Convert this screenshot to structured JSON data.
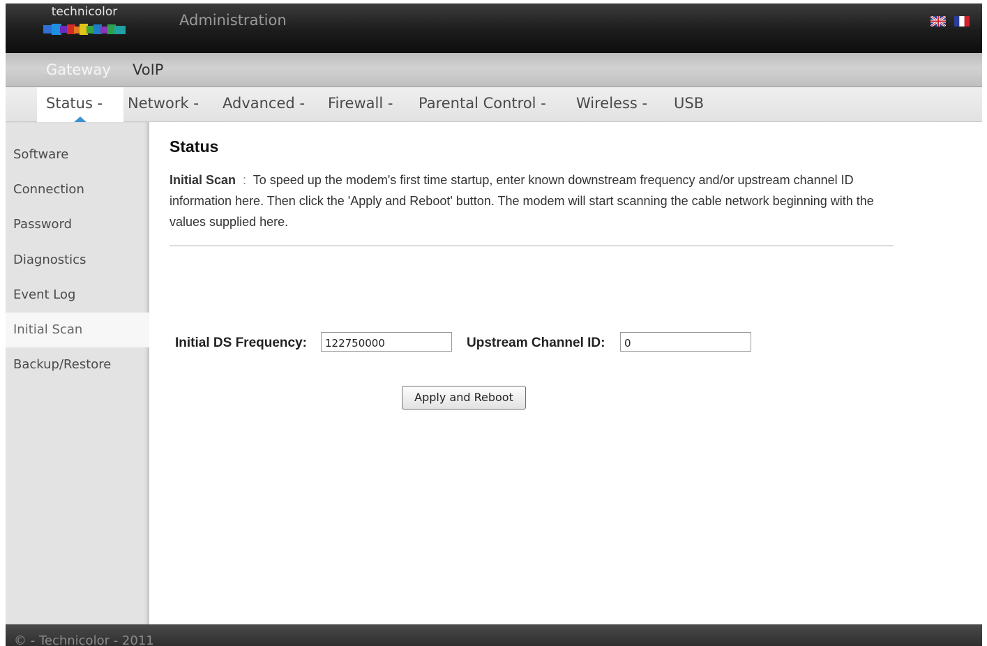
{
  "header": {
    "brand": "technicolor",
    "title": "Administration",
    "languages": [
      {
        "name": "uk-flag-icon"
      },
      {
        "name": "fr-flag-icon"
      }
    ]
  },
  "product_tabs": [
    {
      "label": "Gateway",
      "active": true
    },
    {
      "label": "VoIP",
      "active": false
    }
  ],
  "main_nav": [
    {
      "label": "Status -",
      "active": true
    },
    {
      "label": "Network -",
      "active": false
    },
    {
      "label": "Advanced -",
      "active": false
    },
    {
      "label": "Firewall -",
      "active": false
    },
    {
      "label": "Parental Control -",
      "active": false
    },
    {
      "label": "Wireless -",
      "active": false
    },
    {
      "label": "USB",
      "active": false
    }
  ],
  "sidebar": {
    "items": [
      {
        "label": "Software",
        "active": false
      },
      {
        "label": "Connection",
        "active": false
      },
      {
        "label": "Password",
        "active": false
      },
      {
        "label": "Diagnostics",
        "active": false
      },
      {
        "label": "Event Log",
        "active": false
      },
      {
        "label": "Initial Scan",
        "active": true
      },
      {
        "label": "Backup/Restore",
        "active": false
      }
    ]
  },
  "main": {
    "title": "Status",
    "description_term": "Initial Scan",
    "description_separator": ":",
    "description": "To speed up the modem's first time startup, enter known downstream frequency and/or upstream channel ID information here. Then click the 'Apply and Reboot' button. The modem will start scanning the cable network beginning with the values supplied here.",
    "form": {
      "ds_frequency_label": "Initial DS Frequency:",
      "ds_frequency_value": "122750000",
      "upstream_channel_label": "Upstream Channel ID:",
      "upstream_channel_value": "0",
      "apply_label": "Apply and Reboot"
    }
  },
  "footer": {
    "text": "© - Technicolor - 2011"
  },
  "colors": {
    "accent": "#3d92cf",
    "header_bg": "#1c1c1c",
    "sidebar_bg": "#e3e3e3"
  }
}
